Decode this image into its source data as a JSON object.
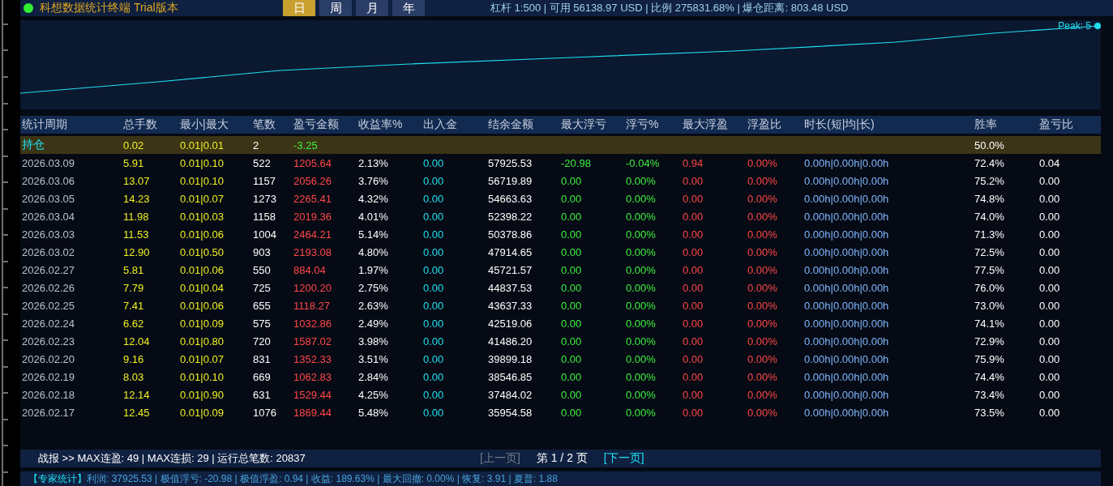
{
  "header": {
    "title": "科想数据统计终端 Trial版本",
    "status": "杠杆 1:500 | 可用 56138.97 USD | 比例 275831.68% | 爆仓距离: 803.48 USD"
  },
  "tabs": [
    {
      "label": "日",
      "selected": true
    },
    {
      "label": "周",
      "selected": false
    },
    {
      "label": "月",
      "selected": false
    },
    {
      "label": "年",
      "selected": false
    }
  ],
  "chart": {
    "peak_label": "Peak: 5"
  },
  "table": {
    "columns": [
      "统计周期",
      "总手数",
      "最小|最大",
      "笔数",
      "盈亏金额",
      "收益率%",
      "出入金",
      "结余金额",
      "最大浮亏",
      "浮亏%",
      "最大浮盈",
      "浮盈比",
      "时长(短|均|长)",
      "胜率",
      "盈亏比"
    ],
    "rows": [
      {
        "kind": "position",
        "cells": [
          "持仓",
          "0.02",
          "0.01|0.01",
          "2",
          "-3.25",
          null,
          null,
          null,
          null,
          null,
          null,
          null,
          null,
          "50.0%",
          null
        ]
      },
      {
        "kind": "day",
        "cells": [
          "2026.03.09",
          "5.91",
          "0.01|0.10",
          "522",
          "1205.64",
          "2.13%",
          "0.00",
          "57925.53",
          "-20.98",
          "-0.04%",
          "0.94",
          "0.00%",
          "0.00h|0.00h|0.00h",
          "72.4%",
          "0.04"
        ]
      },
      {
        "kind": "day",
        "cells": [
          "2026.03.06",
          "13.07",
          "0.01|0.10",
          "1157",
          "2056.26",
          "3.76%",
          "0.00",
          "56719.89",
          "0.00",
          "0.00%",
          "0.00",
          "0.00%",
          "0.00h|0.00h|0.00h",
          "75.2%",
          "0.00"
        ]
      },
      {
        "kind": "day",
        "cells": [
          "2026.03.05",
          "14.23",
          "0.01|0.07",
          "1273",
          "2265.41",
          "4.32%",
          "0.00",
          "54663.63",
          "0.00",
          "0.00%",
          "0.00",
          "0.00%",
          "0.00h|0.00h|0.00h",
          "74.8%",
          "0.00"
        ]
      },
      {
        "kind": "day",
        "cells": [
          "2026.03.04",
          "11.98",
          "0.01|0.03",
          "1158",
          "2019.36",
          "4.01%",
          "0.00",
          "52398.22",
          "0.00",
          "0.00%",
          "0.00",
          "0.00%",
          "0.00h|0.00h|0.00h",
          "74.0%",
          "0.00"
        ]
      },
      {
        "kind": "day",
        "cells": [
          "2026.03.03",
          "11.53",
          "0.01|0.06",
          "1004",
          "2464.21",
          "5.14%",
          "0.00",
          "50378.86",
          "0.00",
          "0.00%",
          "0.00",
          "0.00%",
          "0.00h|0.00h|0.00h",
          "71.3%",
          "0.00"
        ]
      },
      {
        "kind": "day",
        "cells": [
          "2026.03.02",
          "12.90",
          "0.01|0.50",
          "903",
          "2193.08",
          "4.80%",
          "0.00",
          "47914.65",
          "0.00",
          "0.00%",
          "0.00",
          "0.00%",
          "0.00h|0.00h|0.00h",
          "72.5%",
          "0.00"
        ]
      },
      {
        "kind": "day",
        "cells": [
          "2026.02.27",
          "5.81",
          "0.01|0.06",
          "550",
          "884.04",
          "1.97%",
          "0.00",
          "45721.57",
          "0.00",
          "0.00%",
          "0.00",
          "0.00%",
          "0.00h|0.00h|0.00h",
          "77.5%",
          "0.00"
        ]
      },
      {
        "kind": "day",
        "cells": [
          "2026.02.26",
          "7.79",
          "0.01|0.04",
          "725",
          "1200.20",
          "2.75%",
          "0.00",
          "44837.53",
          "0.00",
          "0.00%",
          "0.00",
          "0.00%",
          "0.00h|0.00h|0.00h",
          "76.0%",
          "0.00"
        ]
      },
      {
        "kind": "day",
        "cells": [
          "2026.02.25",
          "7.41",
          "0.01|0.06",
          "655",
          "1118.27",
          "2.63%",
          "0.00",
          "43637.33",
          "0.00",
          "0.00%",
          "0.00",
          "0.00%",
          "0.00h|0.00h|0.00h",
          "73.0%",
          "0.00"
        ]
      },
      {
        "kind": "day",
        "cells": [
          "2026.02.24",
          "6.62",
          "0.01|0.09",
          "575",
          "1032.86",
          "2.49%",
          "0.00",
          "42519.06",
          "0.00",
          "0.00%",
          "0.00",
          "0.00%",
          "0.00h|0.00h|0.00h",
          "74.1%",
          "0.00"
        ]
      },
      {
        "kind": "day",
        "cells": [
          "2026.02.23",
          "12.04",
          "0.01|0.80",
          "720",
          "1587.02",
          "3.98%",
          "0.00",
          "41486.20",
          "0.00",
          "0.00%",
          "0.00",
          "0.00%",
          "0.00h|0.00h|0.00h",
          "72.9%",
          "0.00"
        ]
      },
      {
        "kind": "day",
        "cells": [
          "2026.02.20",
          "9.16",
          "0.01|0.07",
          "831",
          "1352.33",
          "3.51%",
          "0.00",
          "39899.18",
          "0.00",
          "0.00%",
          "0.00",
          "0.00%",
          "0.00h|0.00h|0.00h",
          "75.9%",
          "0.00"
        ]
      },
      {
        "kind": "day",
        "cells": [
          "2026.02.19",
          "8.03",
          "0.01|0.10",
          "669",
          "1062.83",
          "2.84%",
          "0.00",
          "38546.85",
          "0.00",
          "0.00%",
          "0.00",
          "0.00%",
          "0.00h|0.00h|0.00h",
          "74.4%",
          "0.00"
        ]
      },
      {
        "kind": "day",
        "cells": [
          "2026.02.18",
          "12.14",
          "0.01|0.90",
          "631",
          "1529.44",
          "4.25%",
          "0.00",
          "37484.02",
          "0.00",
          "0.00%",
          "0.00",
          "0.00%",
          "0.00h|0.00h|0.00h",
          "73.4%",
          "0.00"
        ]
      },
      {
        "kind": "day",
        "cells": [
          "2026.02.17",
          "12.45",
          "0.01|0.09",
          "1076",
          "1869.44",
          "5.48%",
          "0.00",
          "35954.58",
          "0.00",
          "0.00%",
          "0.00",
          "0.00%",
          "0.00h|0.00h|0.00h",
          "73.5%",
          "0.00"
        ]
      }
    ]
  },
  "footer": {
    "summary": "战报 >> MAX连盈: 49 | MAX连损: 29 | 运行总笔数: 20837",
    "pager": [
      {
        "kind": "prev",
        "label": "[上一页]",
        "disabled": true
      },
      {
        "kind": "info",
        "label": "第 1 / 2 页",
        "disabled": false
      },
      {
        "kind": "next",
        "label": "[下一页]",
        "disabled": false
      }
    ]
  },
  "stats": {
    "label": "【专家统计】",
    "text": "利润: 37925.53 | 极值浮亏: -20.98 | 极值浮盈: 0.94 | 收益: 189.63% | 最大回撤: 0.00% | 恢复: 3.91 | 夏普: 1.88"
  }
}
